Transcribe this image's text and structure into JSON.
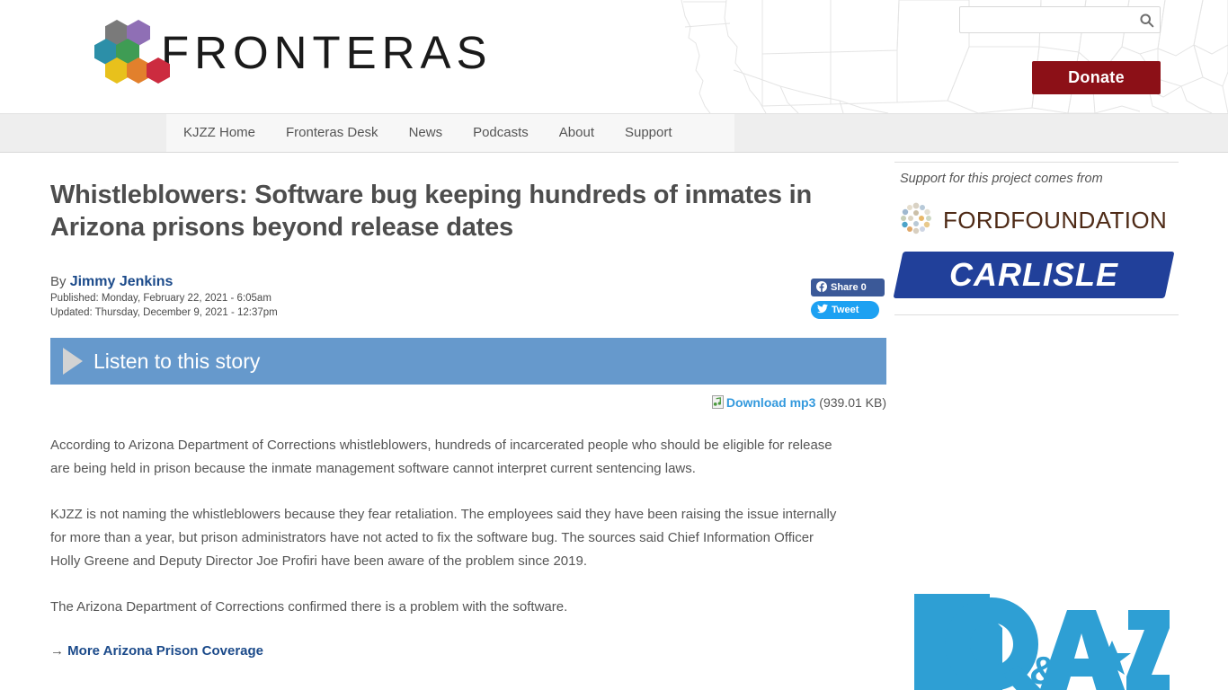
{
  "header": {
    "brand_name": "FRONTERAS",
    "logo_hex_colors": [
      "#7a7a7a",
      "#8f6fb5",
      "#2c8fa8",
      "#3f9c54",
      "#e8c11c",
      "#e2802c",
      "#cc2b3f"
    ],
    "search": {
      "value": "",
      "placeholder": "",
      "icon": "search-icon"
    },
    "donate_label": "Donate",
    "donate_color": "#8c1017",
    "map_icon": "us-southwest-map-outline"
  },
  "nav": {
    "items": [
      {
        "label": "KJZZ Home"
      },
      {
        "label": "Fronteras Desk"
      },
      {
        "label": "News"
      },
      {
        "label": "Podcasts"
      },
      {
        "label": "About"
      },
      {
        "label": "Support"
      }
    ]
  },
  "article": {
    "headline": "Whistleblowers: Software bug keeping hundreds of inmates in Arizona prisons beyond release dates",
    "by_prefix": "By ",
    "author": "Jimmy Jenkins",
    "published": "Published: Monday, February 22, 2021 - 6:05am",
    "updated": "Updated: Thursday, December 9, 2021 - 12:37pm",
    "social": {
      "facebook_label": "Share 0",
      "facebook_color": "#3b5998",
      "twitter_label": "Tweet",
      "twitter_color": "#1da1f2"
    },
    "audio": {
      "listen_label": "Listen to this story",
      "bar_color": "#6699cc",
      "download_label": "Download mp3",
      "file_size": "(939.01 KB)"
    },
    "paragraphs": [
      "According to Arizona Department of Corrections whistleblowers, hundreds of incarcerated people who should be eligible for release are being held in prison because the inmate management software cannot interpret current sentencing laws.",
      "KJZZ is not naming the whistleblowers because they fear retaliation. The employees said they have been raising the issue internally for more than a year, but prison administrators have not acted to fix the software bug. The sources said Chief Information Officer Holly Greene and Deputy Director Joe Profiri have been aware of the problem since 2019.",
      "The Arizona Department of Corrections confirmed there is a problem with the software."
    ],
    "more_arrow": "→ ",
    "more_link": "More Arizona Prison Coverage"
  },
  "sidebar": {
    "support_text": "Support for this project comes from",
    "sponsors": [
      {
        "name": "FORDFOUNDATION",
        "icon": "ford-foundation-logo",
        "color": "#4e2a16"
      },
      {
        "name": "CARLISLE",
        "icon": "carlisle-logo",
        "color": "#21409a"
      }
    ],
    "qaz": {
      "name": "Q&AZ",
      "icon": "qaz-arizona-logo",
      "color": "#2e9fd4"
    }
  }
}
